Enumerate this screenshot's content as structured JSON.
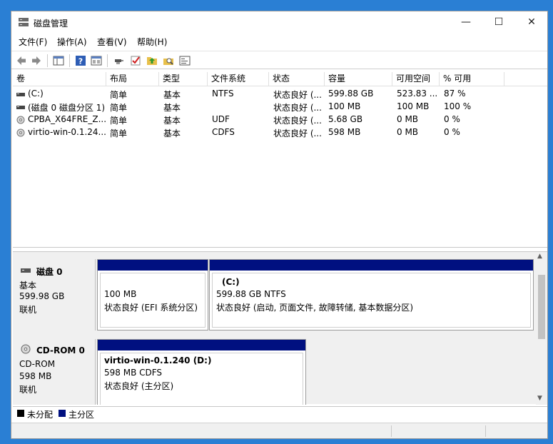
{
  "window": {
    "title": "磁盘管理",
    "controls": {
      "minimize": "—",
      "maximize": "☐",
      "close": "✕"
    }
  },
  "menu": [
    "文件(F)",
    "操作(A)",
    "查看(V)",
    "帮助(H)"
  ],
  "toolbar": [
    "back-icon",
    "forward-icon",
    "show-hide-console-tree-icon",
    "help-icon",
    "properties-icon",
    "connect-icon",
    "checkmark-icon",
    "up-folder-icon",
    "search-icon",
    "console-icon"
  ],
  "columns": [
    "卷",
    "布局",
    "类型",
    "文件系统",
    "状态",
    "容量",
    "可用空间",
    "% 可用"
  ],
  "volumes": [
    {
      "icon": "drive-icon",
      "name": "(C:)",
      "layout": "简单",
      "type": "基本",
      "fs": "NTFS",
      "status": "状态良好 (...",
      "capacity": "599.88 GB",
      "free": "523.83 ...",
      "pct": "87 %"
    },
    {
      "icon": "drive-icon",
      "name": "(磁盘 0 磁盘分区 1)",
      "layout": "简单",
      "type": "基本",
      "fs": "",
      "status": "状态良好 (...",
      "capacity": "100 MB",
      "free": "100 MB",
      "pct": "100 %"
    },
    {
      "icon": "cd-icon",
      "name": "CPBA_X64FRE_Z...",
      "layout": "简单",
      "type": "基本",
      "fs": "UDF",
      "status": "状态良好 (...",
      "capacity": "5.68 GB",
      "free": "0 MB",
      "pct": "0 %"
    },
    {
      "icon": "cd-icon",
      "name": "virtio-win-0.1.24...",
      "layout": "简单",
      "type": "基本",
      "fs": "CDFS",
      "status": "状态良好 (...",
      "capacity": "598 MB",
      "free": "0 MB",
      "pct": "0 %"
    }
  ],
  "disks": [
    {
      "icon": "hard-disk-icon",
      "name": "磁盘 0",
      "kind": "基本",
      "size": "599.98 GB",
      "state": "联机",
      "partitions": [
        {
          "title": "",
          "line1": "100 MB",
          "line2": "状态良好 (EFI 系统分区)"
        },
        {
          "title": "(C:)",
          "line1": "599.88 GB NTFS",
          "line2": "状态良好 (启动, 页面文件, 故障转储, 基本数据分区)"
        }
      ]
    },
    {
      "icon": "cd-rom-icon",
      "name": "CD-ROM 0",
      "kind": "CD-ROM",
      "size": "598 MB",
      "state": "联机",
      "partitions": [
        {
          "title": "virtio-win-0.1.240  (D:)",
          "line1": "598 MB CDFS",
          "line2": "状态良好 (主分区)"
        }
      ]
    }
  ],
  "legend": [
    {
      "label": "未分配",
      "color": "#000000"
    },
    {
      "label": "主分区",
      "color": "#001080"
    }
  ],
  "colors": {
    "primary_partition": "#001080",
    "desktop": "#2a7fd4"
  }
}
